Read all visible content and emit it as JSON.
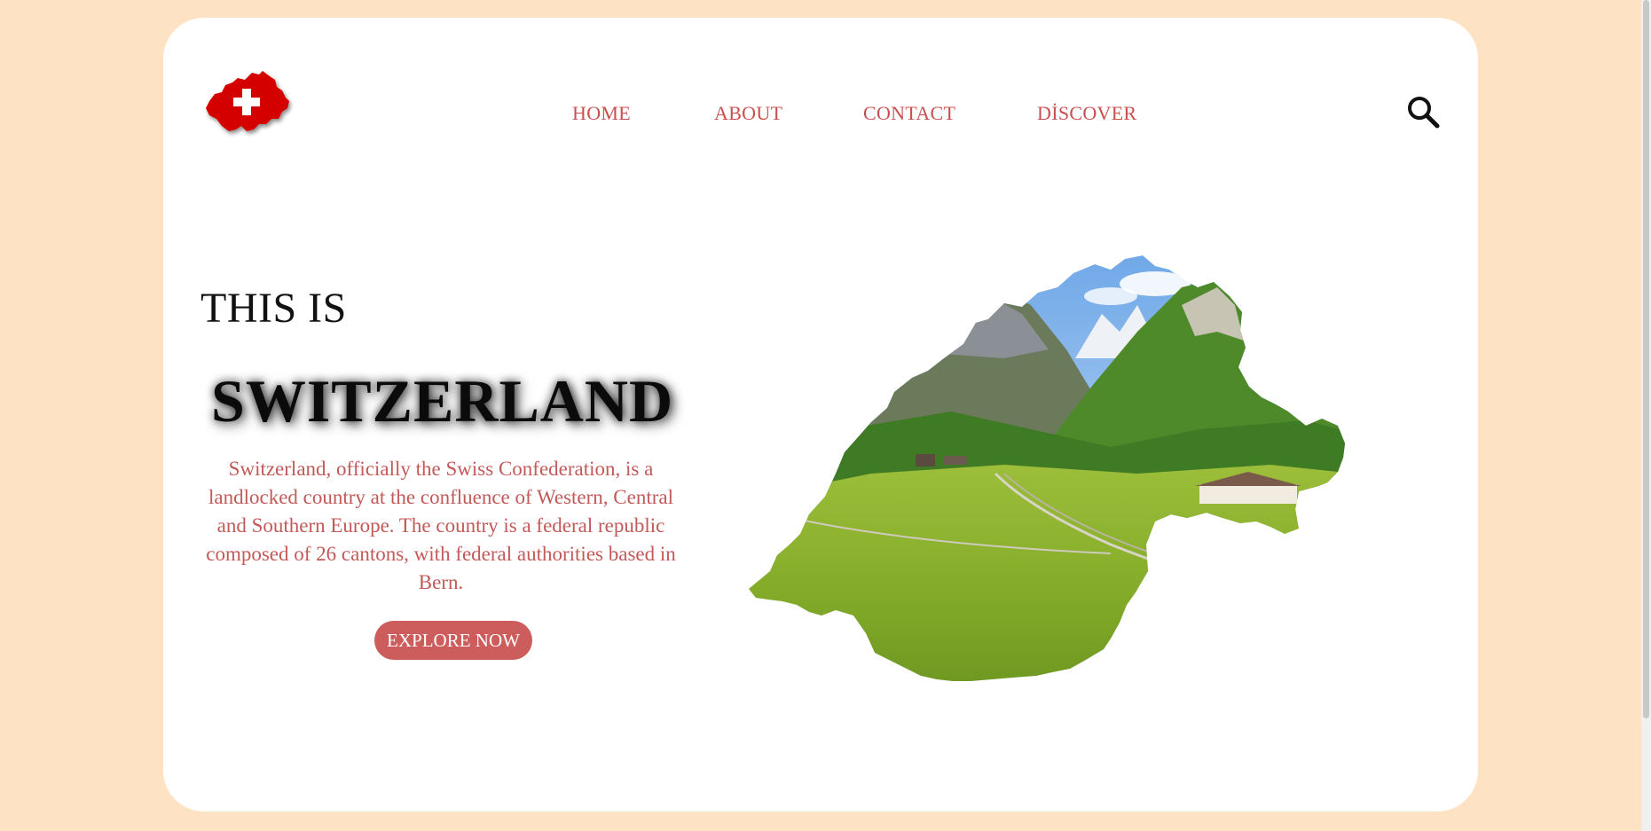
{
  "header": {
    "logo_icon": "swiss-map-cross-icon",
    "nav": [
      {
        "label": "HOME"
      },
      {
        "label": "ABOUT"
      },
      {
        "label": "CONTACT"
      },
      {
        "label": "DİSCOVER"
      }
    ],
    "search_icon": "search-icon"
  },
  "hero": {
    "kicker": "THIS IS",
    "title": "SWITZERLAND",
    "description": "Switzerland, officially the Swiss Confederation, is a landlocked country at the confluence of Western, Central and Southern Europe. The country is a federal republic composed of 26 cantons, with federal authorities based in Bern.",
    "cta_label": "EXPLORE NOW",
    "image": "switzerland-map-landscape"
  },
  "colors": {
    "page_background": "#fde3c3",
    "card_background": "#ffffff",
    "accent": "#c9504f",
    "button": "#cd5c5c",
    "flag_red": "#d40000"
  }
}
